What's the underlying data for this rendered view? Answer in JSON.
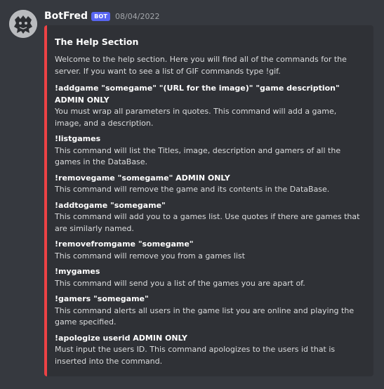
{
  "message": {
    "username": "BotFred",
    "bot_tag": "BOT",
    "timestamp": "08/04/2022"
  },
  "embed": {
    "accent_color": "#ed4245",
    "title": "The Help Section",
    "description": "Welcome to the help section. Here you will find all of the commands for the server. If you want to see a list of GIF commands type !gif.",
    "fields": [
      {
        "name": "!addgame \"somegame\" \"(URL for the image)\" \"game description\" ADMIN ONLY",
        "value": "You must wrap all parameters in quotes. This command will add a game, image, and a description."
      },
      {
        "name": "!listgames",
        "value": "This command will list the Titles, image, description and gamers of all the games in the DataBase."
      },
      {
        "name": "!removegame \"somegame\" ADMIN ONLY",
        "value": "This command will remove the game and its contents in the DataBase."
      },
      {
        "name": "!addtogame \"somegame\"",
        "value": "This command will add you to a games list. Use quotes if there are games that are similarly named."
      },
      {
        "name": "!removefromgame \"somegame\"",
        "value": "This command will remove you from a games list"
      },
      {
        "name": "!mygames",
        "value": "This command will send you a list of the games you are apart of."
      },
      {
        "name": "!gamers \"somegame\"",
        "value": "This command alerts all users in the game list you are online and playing the game specified."
      },
      {
        "name": "!apologize userid  ADMIN ONLY",
        "value": "Must input the users ID. This command apologizes to the users id that is inserted into the command."
      }
    ]
  }
}
